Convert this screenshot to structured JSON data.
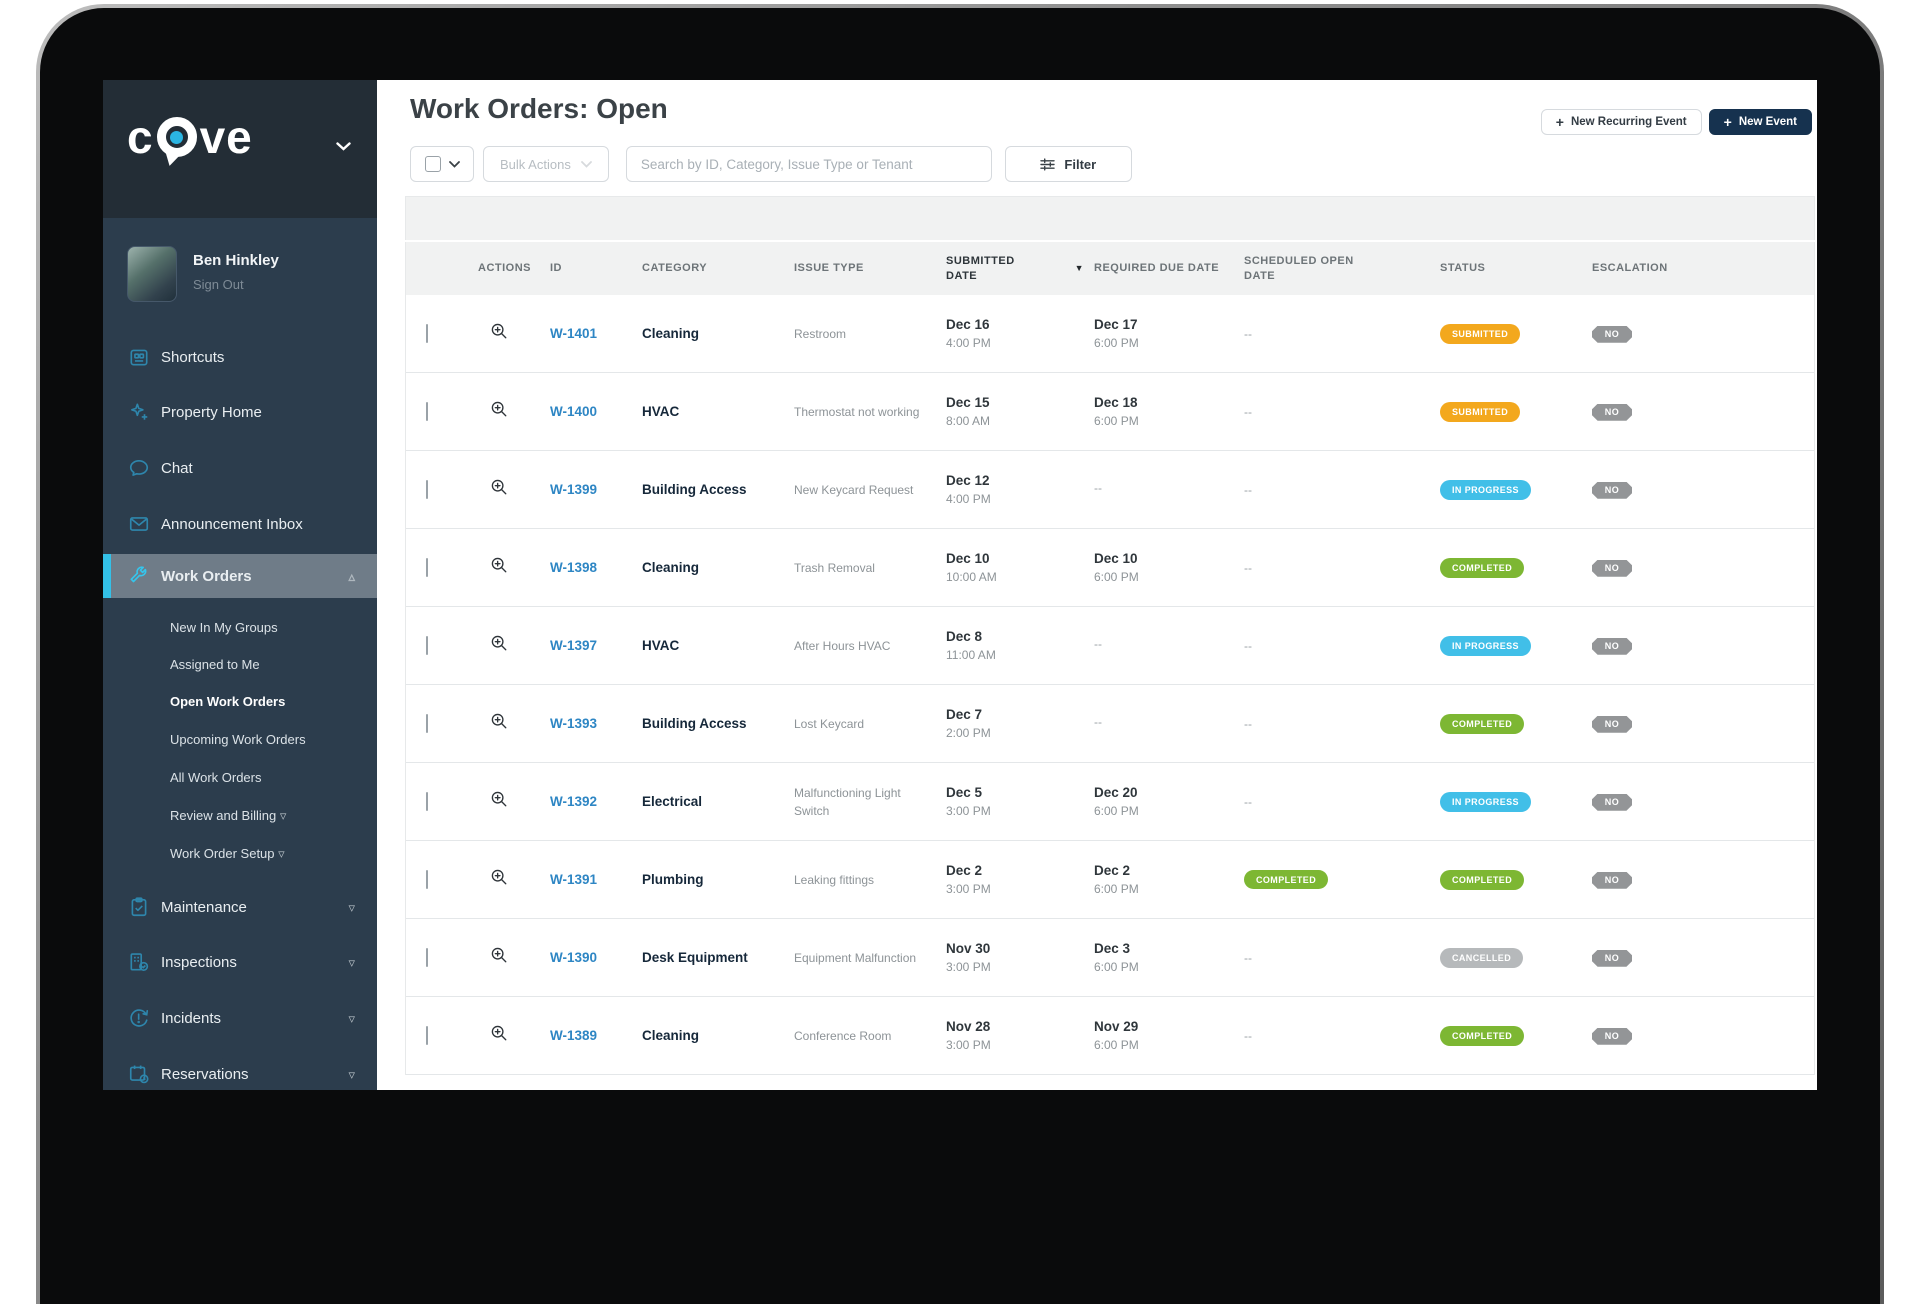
{
  "header": {
    "title": "Work Orders: Open",
    "new_recurring_event": "New Recurring Event",
    "new_event": "New Event",
    "plus": "+"
  },
  "sidebar": {
    "logo": {
      "left": "c",
      "right": "ve"
    },
    "user": {
      "name": "Ben Hinkley",
      "sign_out": "Sign Out"
    },
    "items": [
      {
        "label": "Shortcuts",
        "icon": "shortcuts-icon"
      },
      {
        "label": "Property Home",
        "icon": "property-home-icon"
      },
      {
        "label": "Chat",
        "icon": "chat-icon"
      },
      {
        "label": "Announcement Inbox",
        "icon": "announcement-inbox-icon"
      },
      {
        "label": "Work Orders",
        "icon": "work-orders-icon",
        "active": true
      }
    ],
    "work_orders_children": [
      {
        "label": "New In My Groups"
      },
      {
        "label": "Assigned to Me"
      },
      {
        "label": "Open Work Orders",
        "active": true
      },
      {
        "label": "Upcoming Work Orders"
      },
      {
        "label": "All Work Orders"
      },
      {
        "label": "Review and Billing",
        "chevron": "▿"
      },
      {
        "label": "Work Order Setup",
        "chevron": "▿"
      }
    ],
    "items_bottom": [
      {
        "label": "Maintenance",
        "icon": "maintenance-icon",
        "chevron": "▿"
      },
      {
        "label": "Inspections",
        "icon": "inspections-icon",
        "chevron": "▿"
      },
      {
        "label": "Incidents",
        "icon": "incidents-icon",
        "chevron": "▿"
      },
      {
        "label": "Reservations",
        "icon": "reservations-icon",
        "chevron": "▿"
      }
    ],
    "work_orders_collapse_chevron": "▵"
  },
  "toolbar": {
    "bulk_actions": "Bulk Actions",
    "search_placeholder": "Search by ID, Category, Issue Type or Tenant",
    "filter": "Filter"
  },
  "table": {
    "columns": [
      "ACTIONS",
      "ID",
      "CATEGORY",
      "ISSUE TYPE",
      "SUBMITTED DATE",
      "REQUIRED DUE DATE",
      "SCHEDULED OPEN DATE",
      "STATUS",
      "ESCALATION"
    ],
    "sort_column": "SUBMITTED DATE",
    "sort_indicator": "▼",
    "rows": [
      {
        "id": "W-1401",
        "category": "Cleaning",
        "issue": "Restroom",
        "submitted_date": "Dec 16",
        "submitted_time": "4:00 PM",
        "required_date": "Dec 17",
        "required_time": "6:00 PM",
        "scheduled_text": "--",
        "scheduled_badge": "",
        "status": "SUBMITTED",
        "escalation": "NO"
      },
      {
        "id": "W-1400",
        "category": "HVAC",
        "issue": "Thermostat not working",
        "submitted_date": "Dec 15",
        "submitted_time": "8:00 AM",
        "required_date": "Dec 18",
        "required_time": "6:00 PM",
        "scheduled_text": "--",
        "scheduled_badge": "",
        "status": "SUBMITTED",
        "escalation": "NO"
      },
      {
        "id": "W-1399",
        "category": "Building Access",
        "issue": "New Keycard Request",
        "submitted_date": "Dec 12",
        "submitted_time": "4:00 PM",
        "required_date": "--",
        "required_time": "",
        "scheduled_text": "--",
        "scheduled_badge": "",
        "status": "IN PROGRESS",
        "escalation": "NO"
      },
      {
        "id": "W-1398",
        "category": "Cleaning",
        "issue": "Trash Removal",
        "submitted_date": "Dec 10",
        "submitted_time": "10:00 AM",
        "required_date": "Dec 10",
        "required_time": "6:00 PM",
        "scheduled_text": "--",
        "scheduled_badge": "",
        "status": "COMPLETED",
        "escalation": "NO"
      },
      {
        "id": "W-1397",
        "category": "HVAC",
        "issue": "After Hours HVAC",
        "submitted_date": "Dec 8",
        "submitted_time": "11:00 AM",
        "required_date": "--",
        "required_time": "",
        "scheduled_text": "--",
        "scheduled_badge": "",
        "status": "IN PROGRESS",
        "escalation": "NO"
      },
      {
        "id": "W-1393",
        "category": "Building Access",
        "issue": "Lost Keycard",
        "submitted_date": "Dec 7",
        "submitted_time": "2:00 PM",
        "required_date": "--",
        "required_time": "",
        "scheduled_text": "--",
        "scheduled_badge": "",
        "status": "COMPLETED",
        "escalation": "NO"
      },
      {
        "id": "W-1392",
        "category": "Electrical",
        "issue": "Malfunctioning Light Switch",
        "submitted_date": "Dec 5",
        "submitted_time": "3:00 PM",
        "required_date": "Dec 20",
        "required_time": "6:00 PM",
        "scheduled_text": "--",
        "scheduled_badge": "",
        "status": "IN PROGRESS",
        "escalation": "NO"
      },
      {
        "id": "W-1391",
        "category": "Plumbing",
        "issue": "Leaking fittings",
        "submitted_date": "Dec 2",
        "submitted_time": "3:00 PM",
        "required_date": "Dec 2",
        "required_time": "6:00 PM",
        "scheduled_text": "",
        "scheduled_badge": "COMPLETED",
        "status": "COMPLETED",
        "escalation": "NO"
      },
      {
        "id": "W-1390",
        "category": "Desk Equipment",
        "issue": "Equipment Malfunction",
        "submitted_date": "Nov 30",
        "submitted_time": "3:00 PM",
        "required_date": "Dec 3",
        "required_time": "6:00 PM",
        "scheduled_text": "--",
        "scheduled_badge": "",
        "status": "CANCELLED",
        "escalation": "NO"
      },
      {
        "id": "W-1389",
        "category": "Cleaning",
        "issue": "Conference Room",
        "submitted_date": "Nov 28",
        "submitted_time": "3:00 PM",
        "required_date": "Nov 29",
        "required_time": "6:00 PM",
        "scheduled_text": "--",
        "scheduled_badge": "",
        "status": "COMPLETED",
        "escalation": "NO"
      }
    ]
  },
  "colors": {
    "status": {
      "SUBMITTED": "#f3a81d",
      "IN PROGRESS": "#41bfe8",
      "COMPLETED": "#7db733",
      "CANCELLED": "#b6b9bb"
    },
    "escalation_no": "#939597",
    "accent_cyan": "#33c1e8",
    "brand_navy": "#16324f"
  }
}
